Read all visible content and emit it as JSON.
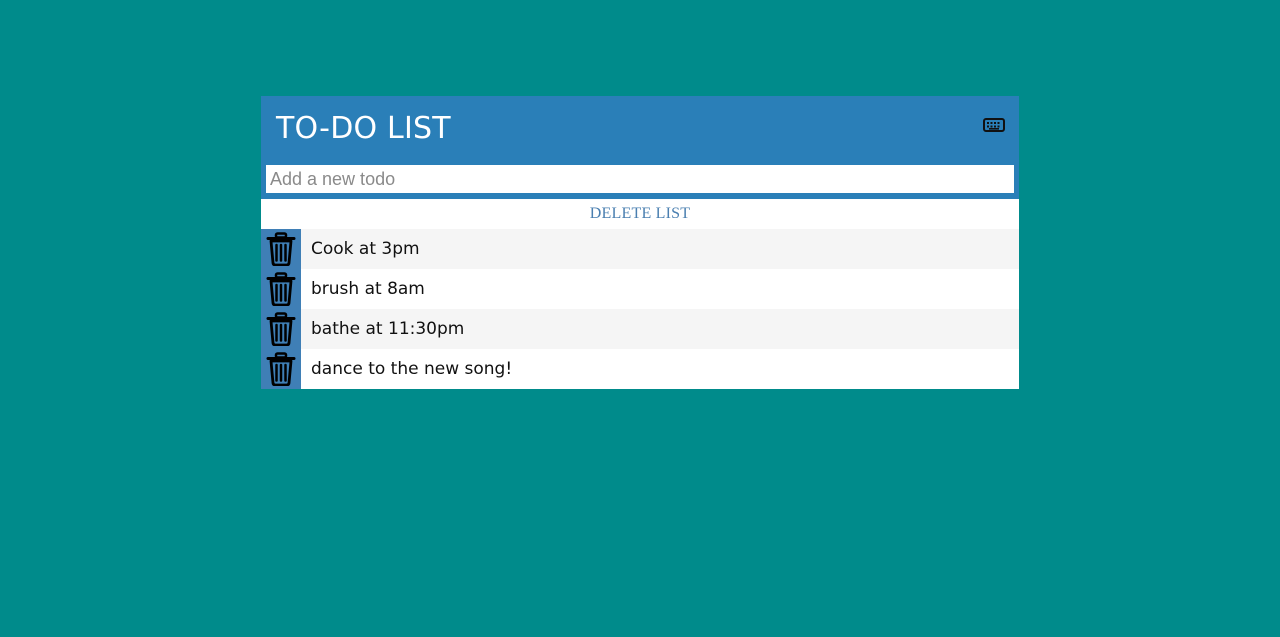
{
  "app": {
    "title": "TO-DO LIST",
    "toggle_icon": "keyboard-icon"
  },
  "input": {
    "placeholder": "Add a new todo",
    "value": ""
  },
  "actions": {
    "delete_list_label": "DELETE LIST"
  },
  "todos": [
    {
      "text": "Cook at 3pm",
      "icon": "trash-icon"
    },
    {
      "text": "brush at 8am",
      "icon": "trash-icon"
    },
    {
      "text": "bathe at 11:30pm",
      "icon": "trash-icon"
    },
    {
      "text": "dance to the new song!",
      "icon": "trash-icon"
    }
  ],
  "colors": {
    "page_background": "#008B8B",
    "header_background": "#2a7fb8",
    "trash_background": "#3f7fb6",
    "delete_list_text": "#4a7fb0"
  }
}
